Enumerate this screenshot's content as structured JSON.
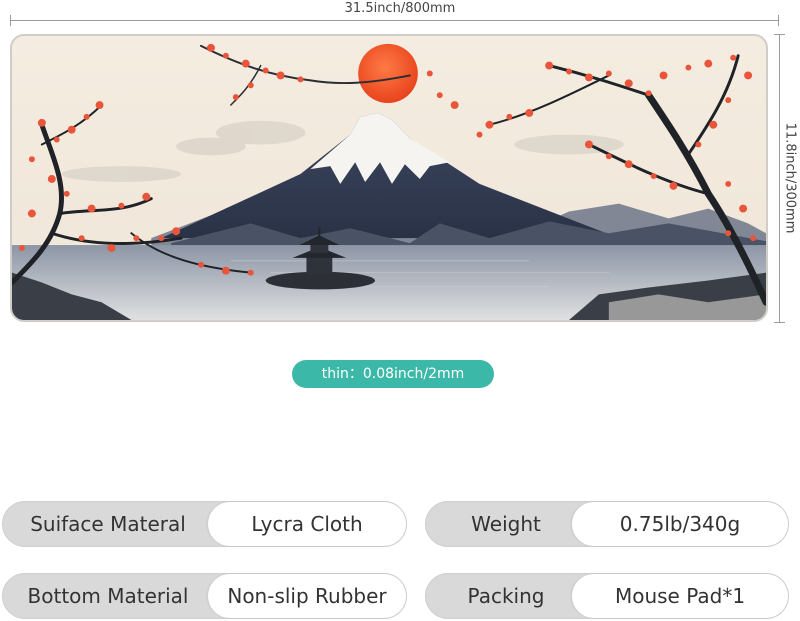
{
  "dimensions": {
    "width": "31.5inch/800mm",
    "height": "11.8inch/300mm",
    "thickness": "thin：0.08inch/2mm"
  },
  "specs": [
    {
      "label": "Suiface Materal",
      "value": "Lycra Cloth"
    },
    {
      "label": "Weight",
      "value": "0.75lb/340g"
    },
    {
      "label": "Bottom Material",
      "value": "Non-slip Rubber"
    },
    {
      "label": "Packing",
      "value": "Mouse Pad*1"
    }
  ],
  "colors": {
    "badge": "#3bb8a8",
    "sun": "#f0552a",
    "blossom": "#e8553a",
    "pill": "#d9d9d9"
  }
}
